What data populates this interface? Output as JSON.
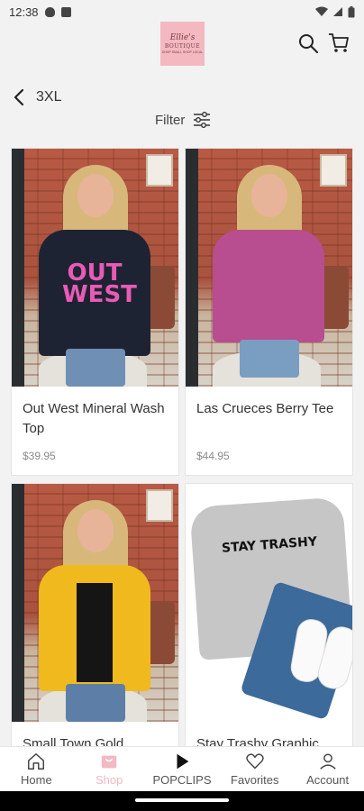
{
  "status_bar": {
    "time": "12:38"
  },
  "header": {
    "logo": {
      "line1": "Ellie's",
      "line2": "BOUTIQUE",
      "line3": "SHOP SMALL SHOP LOCAL"
    }
  },
  "subheader": {
    "back_title": "3XL",
    "filter_label": "Filter"
  },
  "products": [
    {
      "title": "Out West Mineral Wash Top",
      "price": "$39.95",
      "shirt_text": "OUT WEST"
    },
    {
      "title": "Las Crueces Berry Tee",
      "price": "$44.95"
    },
    {
      "title": "Small Town Gold",
      "price": ""
    },
    {
      "title": "Stay Trashy Graphic",
      "price": "",
      "shirt_text": "STAY TRASHY"
    }
  ],
  "bottom_nav": {
    "items": [
      {
        "label": "Home",
        "icon": "home-icon"
      },
      {
        "label": "Shop",
        "icon": "shop-icon",
        "active": true
      },
      {
        "label": "POPCLIPS",
        "icon": "play-icon"
      },
      {
        "label": "Favorites",
        "icon": "heart-icon"
      },
      {
        "label": "Account",
        "icon": "person-icon"
      }
    ]
  },
  "colors": {
    "accent": "#f2b9c4",
    "background": "#f2f2f2"
  }
}
